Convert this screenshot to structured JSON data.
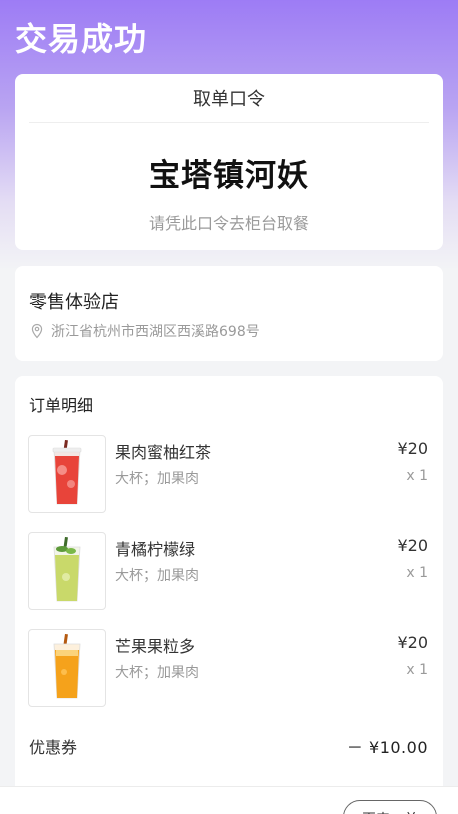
{
  "page": {
    "title": "交易成功"
  },
  "pickup": {
    "header": "取单口令",
    "code": "宝塔镇河妖",
    "hint": "请凭此口令去柜台取餐"
  },
  "store": {
    "name": "零售体验店",
    "address": "浙江省杭州市西湖区西溪路698号",
    "icon": "location-pin-icon"
  },
  "order": {
    "title": "订单明细",
    "items": [
      {
        "name": "果肉蜜柚红茶",
        "spec": "大杯；加果肉",
        "price": "¥20",
        "qty": "x 1",
        "drink_color": "#e8443a"
      },
      {
        "name": "青橘柠檬绿",
        "spec": "大杯；加果肉",
        "price": "¥20",
        "qty": "x 1",
        "drink_color": "#c9d96a"
      },
      {
        "name": "芒果果粒多",
        "spec": "大杯；加果肉",
        "price": "¥20",
        "qty": "x 1",
        "drink_color": "#f5a21b"
      }
    ],
    "coupon_label": "优惠券",
    "coupon_value": "－ ¥10.00"
  },
  "actions": {
    "reorder_label": "再来一单"
  },
  "colors": {
    "header_gradient_top": "#9d7cf5",
    "background": "#f3f4f6"
  }
}
